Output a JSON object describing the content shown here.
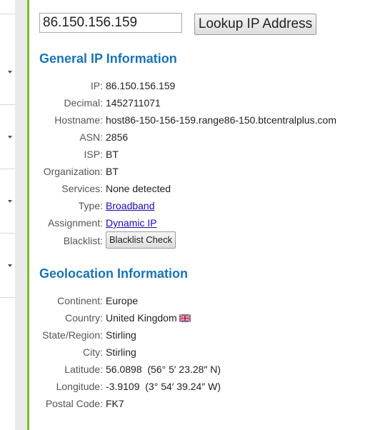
{
  "search": {
    "value": "86.150.156.159",
    "button_label": "Lookup IP Address"
  },
  "general": {
    "heading": "General IP Information",
    "rows": [
      {
        "label": "IP:",
        "value": "86.150.156.159"
      },
      {
        "label": "Decimal:",
        "value": "1452711071"
      },
      {
        "label": "Hostname:",
        "value": "host86-150-156-159.range86-150.btcentralplus.com"
      },
      {
        "label": "ASN:",
        "value": "2856"
      },
      {
        "label": "ISP:",
        "value": "BT"
      },
      {
        "label": "Organization:",
        "value": "BT"
      },
      {
        "label": "Services:",
        "value": "None detected"
      },
      {
        "label": "Type:",
        "value": "Broadband"
      },
      {
        "label": "Assignment:",
        "value": "Dynamic IP"
      },
      {
        "label": "Blacklist:",
        "value": "Blacklist Check"
      }
    ]
  },
  "geo": {
    "heading": "Geolocation Information",
    "rows": [
      {
        "label": "Continent:",
        "value": "Europe"
      },
      {
        "label": "Country:",
        "value": "United Kingdom",
        "icon": "uk-flag-icon"
      },
      {
        "label": "State/Region:",
        "value": "Stirling"
      },
      {
        "label": "City:",
        "value": "Stirling"
      },
      {
        "label": "Latitude:",
        "value": "56.0898  (56° 5′ 23.28″ N)"
      },
      {
        "label": "Longitude:",
        "value": "-3.9109  (3° 54′ 39.24″ W)"
      },
      {
        "label": "Postal Code:",
        "value": "FK7"
      }
    ]
  },
  "colors": {
    "accent": "#1b73b3",
    "link": "#1a0dab",
    "green_border": "#7cbb31"
  },
  "sidebar": {
    "icons": [
      "chevron-down-icon",
      "chevron-down-icon",
      "chevron-down-icon",
      "chevron-down-icon"
    ]
  }
}
